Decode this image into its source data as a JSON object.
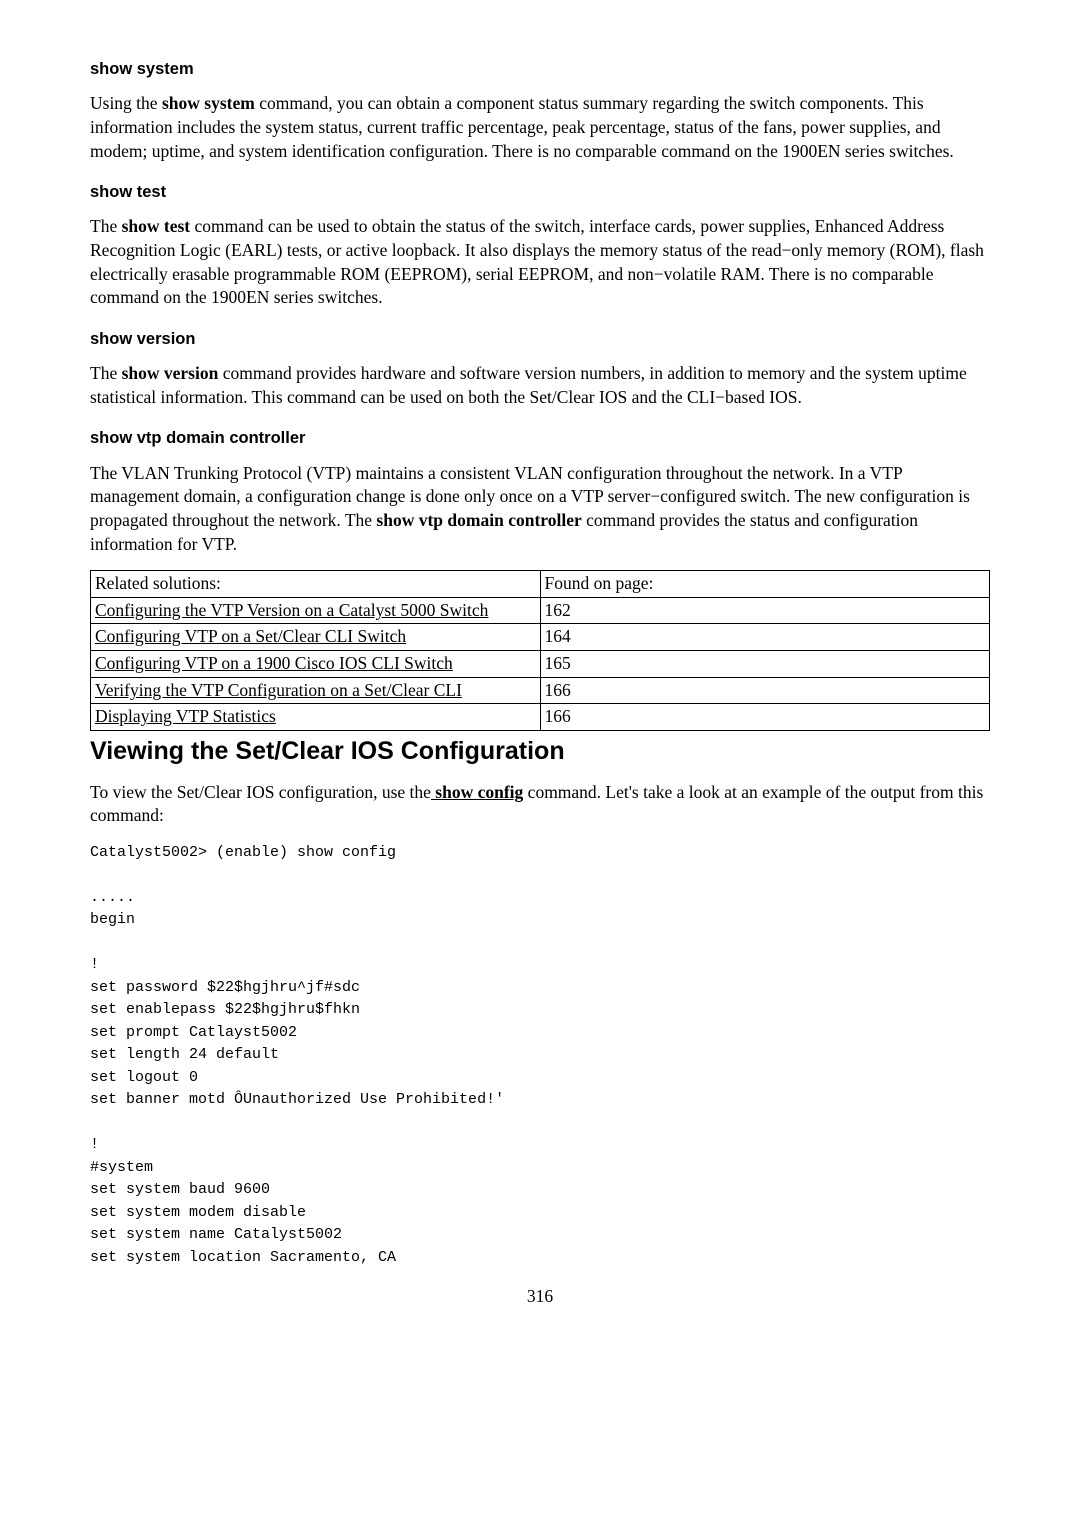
{
  "sections": {
    "show_system": {
      "heading": "show system",
      "para_pre": "Using the ",
      "cmd": "show system",
      "para_post": " command, you can obtain a component status summary regarding the switch components. This information includes the system status, current traffic percentage, peak percentage, status of the fans, power supplies, and modem; uptime, and system identification configuration. There is no comparable command on the 1900EN series switches."
    },
    "show_test": {
      "heading": "show test",
      "para_pre": "The ",
      "cmd": "show test",
      "para_post": " command can be used to obtain the status of the switch, interface cards, power supplies, Enhanced Address Recognition Logic (EARL) tests, or active loopback. It also displays the memory status of the read−only memory (ROM), flash electrically erasable programmable ROM (EEPROM), serial EEPROM, and non−volatile RAM. There is no comparable command on the 1900EN series switches."
    },
    "show_version": {
      "heading": "show version",
      "para_pre": "The ",
      "cmd": "show version",
      "para_post": " command provides hardware and software version numbers, in addition to memory and the system uptime statistical information. This command can be used on both the Set/Clear IOS and the CLI−based IOS."
    },
    "show_vtp": {
      "heading": "show vtp domain controller",
      "para_pre": "The VLAN Trunking Protocol (VTP) maintains a consistent VLAN configuration throughout the network. In a VTP management domain, a configuration change is done only once on a VTP server−configured switch. The new configuration is propagated throughout the network. The ",
      "cmd": "show vtp domain controller",
      "para_post": " command provides the status and configuration information for VTP."
    }
  },
  "table": {
    "header_left": "Related solutions:",
    "header_right": "Found on page:",
    "rows": [
      {
        "label": "Configuring the VTP Version on a Catalyst 5000 Switch",
        "page": "162",
        "multiline": true
      },
      {
        "label": "Configuring VTP on a Set/Clear CLI Switch",
        "page": "164",
        "multiline": false
      },
      {
        "label": "Configuring VTP on a 1900 Cisco IOS CLI Switch",
        "page": "165",
        "multiline": false
      },
      {
        "label": "Verifying the VTP Configuration on a Set/Clear CLI",
        "page": "166",
        "multiline": false
      },
      {
        "label": "Displaying VTP Statistics",
        "page": "166",
        "multiline": false
      }
    ]
  },
  "viewing": {
    "heading": "Viewing the Set/Clear IOS Configuration",
    "para_pre": "To view the Set/Clear IOS configuration, use the",
    "cmd": " show config",
    "para_post": " command. Let's take a look at an example of the output from this command:"
  },
  "code": "Catalyst5002> (enable) show config\n\n.....\nbegin\n\n!\nset password $22$hgjhru^jf#sdc\nset enablepass $22$hgjhru$fhkn\nset prompt Catlayst5002\nset length 24 default\nset logout 0\nset banner motd ÔUnauthorized Use Prohibited!'\n\n!\n#system\nset system baud 9600\nset system modem disable\nset system name Catalyst5002\nset system location Sacramento, CA",
  "page_number": "316"
}
